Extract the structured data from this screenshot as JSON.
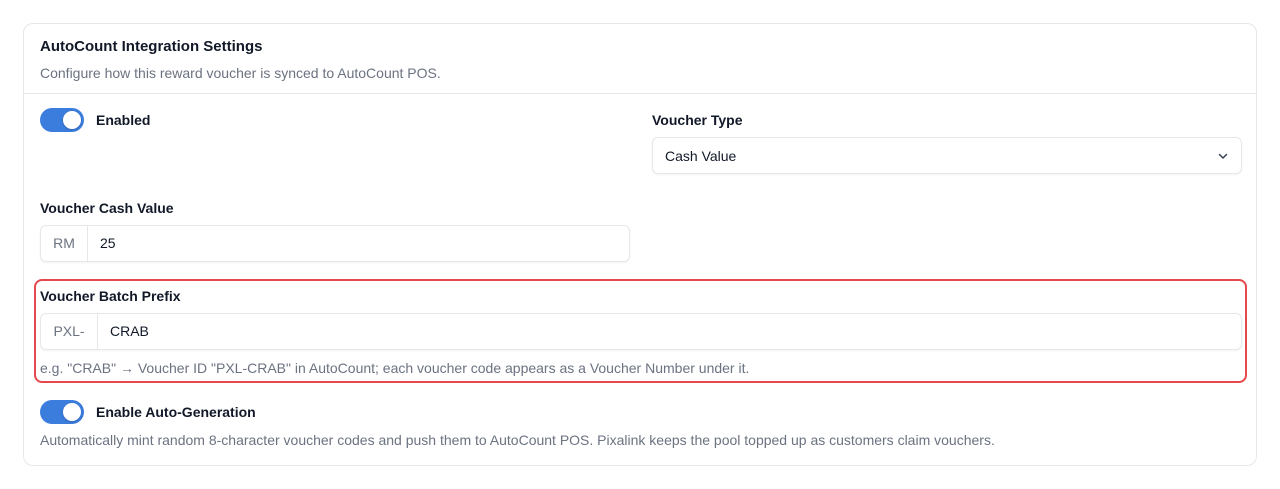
{
  "card": {
    "title": "AutoCount Integration Settings",
    "description": "Configure how this reward voucher is synced to AutoCount POS."
  },
  "enabled_toggle": {
    "label": "Enabled",
    "on": true
  },
  "voucher_type": {
    "label": "Voucher Type",
    "value": "Cash Value"
  },
  "cash_value": {
    "label": "Voucher Cash Value",
    "prefix": "RM",
    "value": "25"
  },
  "batch_prefix": {
    "label": "Voucher Batch Prefix",
    "prefix": "PXL-",
    "value": "CRAB",
    "helper": "e.g. \"CRAB\" → Voucher ID \"PXL-CRAB\" in AutoCount; each voucher code appears as a Voucher Number under it."
  },
  "auto_generation": {
    "label": "Enable Auto-Generation",
    "on": true,
    "description": "Automatically mint random 8-character voucher codes and push them to AutoCount POS. Pixalink keeps the pool topped up as customers claim vouchers."
  },
  "colors": {
    "accent": "#3b7ddd",
    "highlight": "#e5484d",
    "border": "#e5e7eb",
    "muted": "#6b7280"
  }
}
